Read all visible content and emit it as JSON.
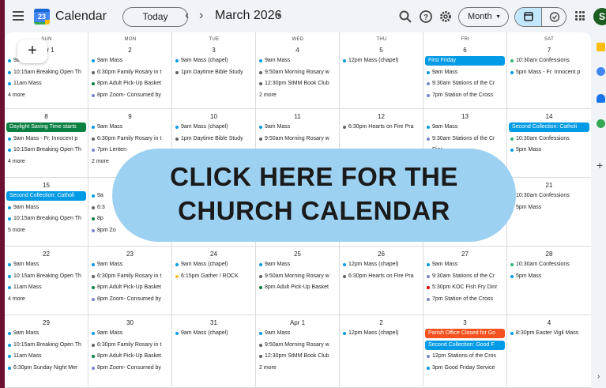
{
  "app": {
    "title": "Calendar",
    "logo_number": "23"
  },
  "toolbar": {
    "today_label": "Today",
    "prev_icon": "chevron-left-icon",
    "next_icon": "chevron-right-icon",
    "month_label": "March 2026",
    "view_label": "Month",
    "avatar_initial": "S"
  },
  "colors": {
    "blue": "#039be5",
    "gray": "#616161",
    "olive": "#33b679",
    "lavender": "#7986cb",
    "green": "#0b8043",
    "dark": "#3f3f3f",
    "yellow": "#f6bf26",
    "red": "#d50000",
    "tomato": "#f4511e",
    "chip_blue": "#039be5",
    "chip_green": "#0b8043"
  },
  "weekdays": [
    "SUN",
    "MON",
    "TUE",
    "WED",
    "THU",
    "FRI",
    "SAT"
  ],
  "weeks": [
    [
      {
        "date": "Mar 1",
        "events": [
          {
            "text": "9am Mass",
            "c": "blue"
          },
          {
            "text": "10:15am Breaking Open Th",
            "c": "blue"
          },
          {
            "text": "11am Mass",
            "c": "blue"
          }
        ],
        "more": "4 more"
      },
      {
        "date": "2",
        "events": [
          {
            "text": "9am Mass",
            "c": "blue"
          },
          {
            "text": "6:30pm Family Rosary in t",
            "c": "gray"
          },
          {
            "text": "8pm Adult Pick-Up Basket",
            "c": "green"
          },
          {
            "text": "8pm Zoom- Consumed by",
            "c": "lavender"
          }
        ]
      },
      {
        "date": "3",
        "events": [
          {
            "text": "9am Mass (chapel)",
            "c": "blue"
          },
          {
            "text": "1pm Daytime Bible Study",
            "c": "gray"
          }
        ]
      },
      {
        "date": "4",
        "events": [
          {
            "text": "9am Mass",
            "c": "blue"
          },
          {
            "text": "9:50am Morning Rosary w",
            "c": "gray"
          },
          {
            "text": "12:30pm StMM Book Club",
            "c": "gray"
          }
        ],
        "more": "2 more"
      },
      {
        "date": "5",
        "events": [
          {
            "text": "12pm Mass (chapel)",
            "c": "blue"
          }
        ]
      },
      {
        "date": "6",
        "chips": [
          {
            "text": "First Friday",
            "c": "chip_blue"
          }
        ],
        "events": [
          {
            "text": "9am Mass",
            "c": "blue"
          },
          {
            "text": "9:30am Stations of the Cr",
            "c": "lavender"
          },
          {
            "text": "7pm Station of the Cross",
            "c": "lavender"
          }
        ]
      },
      {
        "date": "7",
        "events": [
          {
            "text": "10:30am Confessions",
            "c": "olive"
          },
          {
            "text": "5pm Mass - Fr. Innocent p",
            "c": "blue"
          }
        ]
      }
    ],
    [
      {
        "date": "8",
        "chips": [
          {
            "text": "Daylight Saving Time starts",
            "c": "chip_green"
          }
        ],
        "events": [
          {
            "text": "9am Mass - Fr. Innocent p",
            "c": "blue"
          },
          {
            "text": "10:15am Breaking Open Th",
            "c": "blue"
          }
        ],
        "more": "4 more"
      },
      {
        "date": "9",
        "events": [
          {
            "text": "9am Mass",
            "c": "blue"
          },
          {
            "text": "6:30pm Family Rosary in t",
            "c": "gray"
          },
          {
            "text": "7pm Lenten",
            "c": "lavender"
          }
        ],
        "more": "2 more"
      },
      {
        "date": "10",
        "events": [
          {
            "text": "9am Mass (chapel)",
            "c": "blue"
          },
          {
            "text": "1pm Daytime Bible Study",
            "c": "gray"
          }
        ]
      },
      {
        "date": "11",
        "events": [
          {
            "text": "9am Mass",
            "c": "blue"
          },
          {
            "text": "9:50am Morning Rosary w",
            "c": "gray"
          }
        ]
      },
      {
        "date": "12",
        "events": [
          {
            "text": "6:30pm Hearts on Fire Pra",
            "c": "gray"
          }
        ]
      },
      {
        "date": "13",
        "events": [
          {
            "text": "9am Mass",
            "c": "blue"
          },
          {
            "text": "9:30am Stations of the Cr",
            "c": "lavender"
          },
          {
            "text": "Dinr",
            "c": "red"
          }
        ]
      },
      {
        "date": "14",
        "chips": [
          {
            "text": "Second Collection: Catholi",
            "c": "chip_blue"
          }
        ],
        "events": [
          {
            "text": "10:30am Confessions",
            "c": "olive"
          },
          {
            "text": "5pm Mass",
            "c": "blue"
          }
        ]
      }
    ],
    [
      {
        "date": "15",
        "chips": [
          {
            "text": "Second Collection: Catholi",
            "c": "chip_blue"
          }
        ],
        "events": [
          {
            "text": "9am Mass",
            "c": "blue"
          },
          {
            "text": "10:15am Breaking Open Th",
            "c": "blue"
          }
        ],
        "more": "5 more"
      },
      {
        "date": "16",
        "events": [
          {
            "text": "9a",
            "c": "blue"
          },
          {
            "text": "6:3",
            "c": "gray"
          },
          {
            "text": "8p",
            "c": "green"
          },
          {
            "text": "8pm Zo",
            "c": "lavender"
          }
        ]
      },
      {
        "date": "",
        "events": []
      },
      {
        "date": "",
        "events": []
      },
      {
        "date": "",
        "events": []
      },
      {
        "date": "",
        "events": []
      },
      {
        "date": "21",
        "events": [
          {
            "text": "10:30am Confessions",
            "c": "olive"
          },
          {
            "text": "5pm Mass",
            "c": "blue"
          }
        ]
      }
    ],
    [
      {
        "date": "22",
        "events": [
          {
            "text": "9am Mass",
            "c": "blue"
          },
          {
            "text": "10:15am Breaking Open Th",
            "c": "blue"
          },
          {
            "text": "11am Mass",
            "c": "blue"
          }
        ],
        "more": "4 more"
      },
      {
        "date": "23",
        "events": [
          {
            "text": "9am Mass",
            "c": "blue"
          },
          {
            "text": "6:30pm Family Rosary in t",
            "c": "gray"
          },
          {
            "text": "8pm Adult Pick-Up Basket",
            "c": "green"
          },
          {
            "text": "8pm Zoom- Consumed by",
            "c": "lavender"
          }
        ]
      },
      {
        "date": "24",
        "events": [
          {
            "text": "9am Mass (chapel)",
            "c": "blue"
          },
          {
            "text": "6:15pm Gather / ROCK",
            "c": "yellow"
          }
        ]
      },
      {
        "date": "25",
        "events": [
          {
            "text": "9am Mass",
            "c": "blue"
          },
          {
            "text": "9:50am Morning Rosary w",
            "c": "gray"
          },
          {
            "text": "8pm Adult Pick-Up Basket",
            "c": "green"
          }
        ]
      },
      {
        "date": "26",
        "events": [
          {
            "text": "12pm Mass (chapel)",
            "c": "blue"
          },
          {
            "text": "6:30pm Hearts on Fire Pra",
            "c": "gray"
          }
        ]
      },
      {
        "date": "27",
        "events": [
          {
            "text": "9am Mass",
            "c": "blue"
          },
          {
            "text": "9:30am Stations of the Cr",
            "c": "lavender"
          },
          {
            "text": "5:30pm KOC Fish Fry Dinr",
            "c": "red"
          },
          {
            "text": "7pm Station of the Cross",
            "c": "lavender"
          }
        ]
      },
      {
        "date": "28",
        "events": [
          {
            "text": "10:30am Confessions",
            "c": "olive"
          },
          {
            "text": "5pm Mass",
            "c": "blue"
          }
        ]
      }
    ],
    [
      {
        "date": "29",
        "events": [
          {
            "text": "9am Mass",
            "c": "blue"
          },
          {
            "text": "10:15am Breaking Open Th",
            "c": "blue"
          },
          {
            "text": "11am Mass",
            "c": "blue"
          },
          {
            "text": "6:30pm Sunday Night Mer",
            "c": "blue"
          }
        ]
      },
      {
        "date": "30",
        "events": [
          {
            "text": "9am Mass",
            "c": "blue"
          },
          {
            "text": "6:30pm Family Rosary in t",
            "c": "gray"
          },
          {
            "text": "8pm Adult Pick-Up Basket",
            "c": "green"
          },
          {
            "text": "8pm Zoom- Consumed by",
            "c": "lavender"
          }
        ]
      },
      {
        "date": "31",
        "events": [
          {
            "text": "9am Mass (chapel)",
            "c": "blue"
          }
        ]
      },
      {
        "date": "Apr 1",
        "events": [
          {
            "text": "9am Mass",
            "c": "blue"
          },
          {
            "text": "9:50am Morning Rosary w",
            "c": "gray"
          },
          {
            "text": "12:30pm StMM Book Club",
            "c": "gray"
          }
        ],
        "more": "2 more"
      },
      {
        "date": "2",
        "events": [
          {
            "text": "12pm Mass (chapel)",
            "c": "blue"
          }
        ]
      },
      {
        "date": "3",
        "chips": [
          {
            "text": "Parish Office Closed for Go",
            "c": "tomato"
          },
          {
            "text": "Second Collection: Good F",
            "c": "chip_blue"
          }
        ],
        "events": [
          {
            "text": "12pm Stations of the Cros",
            "c": "lavender"
          },
          {
            "text": "3pm Good Friday Service",
            "c": "blue"
          }
        ]
      },
      {
        "date": "4",
        "events": [
          {
            "text": "8:30pm Easter Vigil Mass",
            "c": "blue"
          }
        ]
      }
    ]
  ],
  "overlay": {
    "line1": "CLICK HERE FOR THE",
    "line2": "CHURCH CALENDAR"
  },
  "fab_label": "+"
}
